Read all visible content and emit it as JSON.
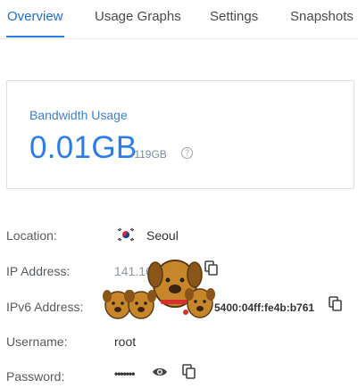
{
  "tabs": [
    {
      "label": "Overview",
      "active": true
    },
    {
      "label": "Usage Graphs",
      "active": false
    },
    {
      "label": "Settings",
      "active": false
    },
    {
      "label": "Snapshots",
      "active": false
    }
  ],
  "bandwidth": {
    "label": "Bandwidth Usage",
    "used": "0.01GB",
    "total": "/119GB",
    "help_icon": "?"
  },
  "details": {
    "location": {
      "label": "Location:",
      "value": "Seoul",
      "flag": "south-korea-flag-icon"
    },
    "ip": {
      "label": "IP Address:",
      "value": "141.16"
    },
    "ipv6": {
      "label": "IPv6 Address:",
      "value": "5400:04ff:fe4b:b761"
    },
    "username": {
      "label": "Username:",
      "value": "root"
    },
    "password": {
      "label": "Password:",
      "value": "•••••••"
    }
  },
  "colors": {
    "accent": "#2b7de9",
    "text": "#3a3a3a",
    "muted": "#8e96a0",
    "border": "#dde1e6"
  }
}
